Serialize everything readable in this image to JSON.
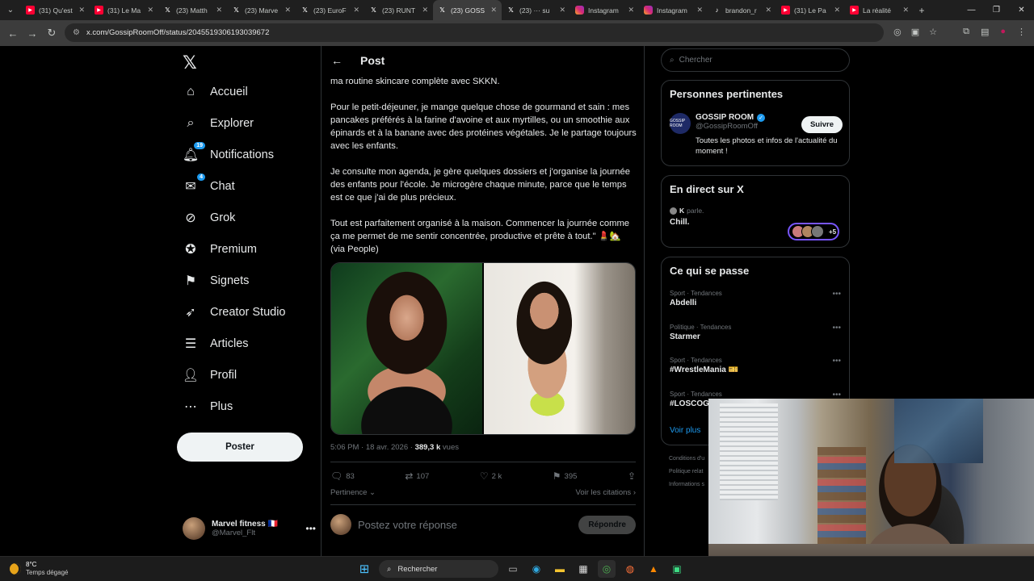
{
  "browser": {
    "tabs": [
      {
        "label": "(31) Qu'est",
        "icon": "youtube-icon",
        "kind": "yt"
      },
      {
        "label": "(31) Le Ma",
        "icon": "youtube-icon",
        "kind": "yt"
      },
      {
        "label": "(23) Matth",
        "icon": "x-icon",
        "kind": "x"
      },
      {
        "label": "(23) Marve",
        "icon": "x-icon",
        "kind": "x"
      },
      {
        "label": "(23) EuroF",
        "icon": "x-icon",
        "kind": "x"
      },
      {
        "label": "(23) RUNT",
        "icon": "x-icon",
        "kind": "x"
      },
      {
        "label": "(23) GOSS",
        "icon": "x-icon",
        "kind": "x",
        "active": true
      },
      {
        "label": "(23) ··· su",
        "icon": "x-icon",
        "kind": "x"
      },
      {
        "label": "Instagram",
        "icon": "instagram-icon",
        "kind": "ig"
      },
      {
        "label": "Instagram",
        "icon": "instagram-icon",
        "kind": "ig"
      },
      {
        "label": "brandon_r",
        "icon": "tiktok-icon",
        "kind": "tk"
      },
      {
        "label": "(31) Le Pa",
        "icon": "youtube-icon",
        "kind": "yt"
      },
      {
        "label": "La réalité",
        "icon": "youtube-icon",
        "kind": "yt"
      }
    ],
    "url": "x.com/GossipRoomOff/status/2045519306193039672"
  },
  "nav": {
    "items": [
      {
        "label": "Accueil",
        "icon": "home-icon"
      },
      {
        "label": "Explorer",
        "icon": "search-icon"
      },
      {
        "label": "Notifications",
        "icon": "bell-icon",
        "badge": "19"
      },
      {
        "label": "Chat",
        "icon": "chat-icon",
        "badge": "4"
      },
      {
        "label": "Grok",
        "icon": "grok-icon"
      },
      {
        "label": "Premium",
        "icon": "premium-icon"
      },
      {
        "label": "Signets",
        "icon": "bookmark-icon"
      },
      {
        "label": "Creator Studio",
        "icon": "rocket-icon"
      },
      {
        "label": "Articles",
        "icon": "articles-icon"
      },
      {
        "label": "Profil",
        "icon": "profile-icon"
      },
      {
        "label": "Plus",
        "icon": "more-icon"
      }
    ],
    "post_button": "Poster",
    "account": {
      "name": "Marvel fitness 🇫🇷",
      "handle": "@Marvel_Flt"
    }
  },
  "post": {
    "header_title": "Post",
    "text": "ma routine skincare complète avec SKKN.\n\nPour le petit-déjeuner, je mange quelque chose de gourmand et sain : mes pancakes préférés à la farine d'avoine et aux myrtilles, ou un smoothie aux épinards et à la banane avec des protéines végétales. Je le partage toujours avec les enfants.\n\nJe consulte mon agenda, je gère quelques dossiers et j'organise la journée des enfants pour l'école. Je microgère chaque minute, parce que le temps est ce que j'ai de plus précieux.\n\nTout est parfaitement organisé à la maison. Commencer la journée comme ça me permet de me sentir concentrée, productive et prête à tout.\" 💄🏡 (via People)",
    "timestamp": "5:06 PM · 18 avr. 2026 · ",
    "views_count": "389,3 k",
    "views_label": " vues",
    "replies": "83",
    "reposts": "107",
    "likes": "2 k",
    "bookmarks": "395",
    "sort_label": "Pertinence",
    "quotes_label": "Voir les citations",
    "reply_placeholder": "Postez votre réponse",
    "reply_button": "Répondre"
  },
  "sidebar": {
    "search_placeholder": "Chercher",
    "relevant": {
      "title": "Personnes pertinentes",
      "name": "GOSSIP ROOM",
      "handle": "@GossipRoomOff",
      "avatar_text": "GOSSIP ROOM",
      "bio": "Toutes les photos et infos de l'actualité du moment !",
      "follow": "Suivre"
    },
    "live": {
      "title": "En direct sur X",
      "host": "K",
      "speaking": "parle.",
      "space_title": "Chill.",
      "extra": "+5"
    },
    "trends": {
      "title": "Ce qui se passe",
      "items": [
        {
          "category": "Sport · Tendances",
          "name": "Abdelli"
        },
        {
          "category": "Politique · Tendances",
          "name": "Starmer"
        },
        {
          "category": "Sport · Tendances",
          "name": "#WrestleMania 🎫"
        },
        {
          "category": "Sport · Tendances",
          "name": "#LOSCOG"
        }
      ],
      "see_more": "Voir plus"
    },
    "footer": [
      "Conditions d'u",
      "Politique relat",
      "Informations s"
    ]
  },
  "taskbar": {
    "weather_temp": "8°C",
    "weather_desc": "Temps dégagé",
    "search_label": "Rechercher"
  }
}
